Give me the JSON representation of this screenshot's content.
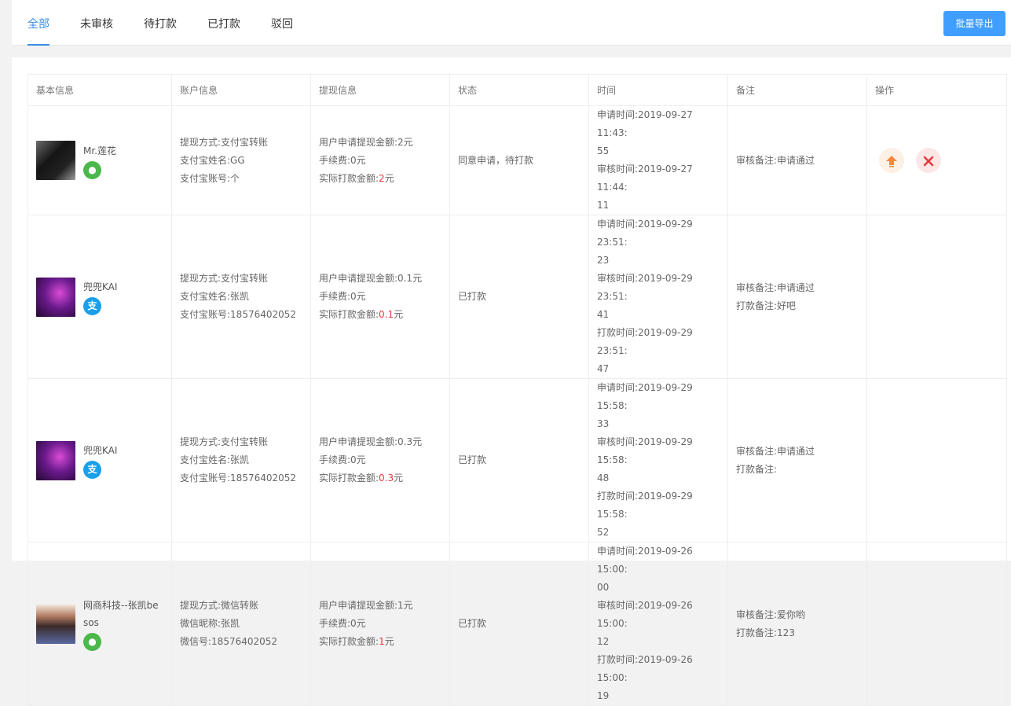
{
  "tabs": [
    "全部",
    "未审核",
    "待打款",
    "已打款",
    "驳回"
  ],
  "export_label": "批量导出",
  "columns": [
    "基本信息",
    "账户信息",
    "提现信息",
    "状态",
    "时间",
    "备注",
    "操作"
  ],
  "rows": [
    {
      "nick": "Mr.莲花",
      "pay_type": "wechat",
      "account": [
        "提现方式:支付宝转账",
        "支付宝姓名:GG",
        "支付宝账号:个"
      ],
      "apply_amount": "用户申请提现金额:2元",
      "fee": "手续费:0元",
      "actual_prefix": "实际打款金额:",
      "actual_value": "2",
      "actual_suffix": "元",
      "status": "同意申请，待打款",
      "times": [
        "申请时间:2019-09-27 11:43:",
        "55",
        "审核时间:2019-09-27 11:44:",
        "11"
      ],
      "notes": [
        "审核备注:申请通过"
      ],
      "ops": true
    },
    {
      "nick": "兜兜KAI",
      "pay_type": "alipay",
      "account": [
        "提现方式:支付宝转账",
        "支付宝姓名:张凯",
        "支付宝账号:18576402052"
      ],
      "apply_amount": "用户申请提现金额:0.1元",
      "fee": "手续费:0元",
      "actual_prefix": "实际打款金额:",
      "actual_value": "0.1",
      "actual_suffix": "元",
      "status": "已打款",
      "times": [
        "申请时间:2019-09-29 23:51:",
        "23",
        "审核时间:2019-09-29 23:51:",
        "41",
        "打款时间:2019-09-29 23:51:",
        "47"
      ],
      "notes": [
        "审核备注:申请通过",
        "打款备注:好吧"
      ],
      "ops": false
    },
    {
      "nick": "兜兜KAI",
      "pay_type": "alipay",
      "account": [
        "提现方式:支付宝转账",
        "支付宝姓名:张凯",
        "支付宝账号:18576402052"
      ],
      "apply_amount": "用户申请提现金额:0.3元",
      "fee": "手续费:0元",
      "actual_prefix": "实际打款金额:",
      "actual_value": "0.3",
      "actual_suffix": "元",
      "status": "已打款",
      "times": [
        "申请时间:2019-09-29 15:58:",
        "33",
        "审核时间:2019-09-29 15:58:",
        "48",
        "打款时间:2019-09-29 15:58:",
        "52"
      ],
      "notes": [
        "审核备注:申请通过",
        "打款备注:"
      ],
      "ops": false
    },
    {
      "nick": "网商科技--张凯be",
      "nick2": "sos",
      "pay_type": "wechat",
      "account": [
        "提现方式:微信转账",
        "微信昵称:张凯",
        "微信号:18576402052"
      ],
      "apply_amount": "用户申请提现金额:1元",
      "fee": "手续费:0元",
      "actual_prefix": "实际打款金额:",
      "actual_value": "1",
      "actual_suffix": "元",
      "status": "已打款",
      "times": [
        "申请时间:2019-09-26 15:00:",
        "00",
        "审核时间:2019-09-26 15:00:",
        "12",
        "打款时间:2019-09-26 15:00:",
        "19"
      ],
      "notes": [
        "审核备注:爱你哟",
        "打款备注:123"
      ],
      "ops": false
    }
  ],
  "colors": {
    "accent": "#409eff",
    "tab_active": "#3a8ee6",
    "amount_red": "#e8383d",
    "wechat_green": "#4cb84c",
    "alipay_blue": "#1aa0e8"
  },
  "icons": {
    "wechat": "wechat-icon",
    "alipay": "alipay-icon",
    "pass": "upload-arrow-icon",
    "reject": "close-icon"
  }
}
